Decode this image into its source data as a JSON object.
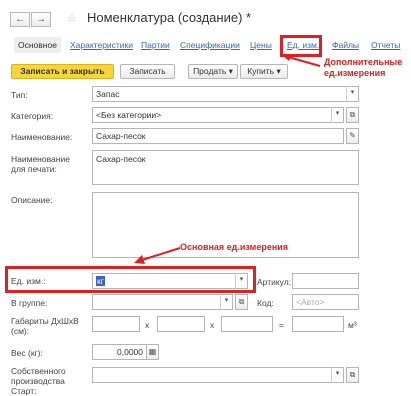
{
  "header": {
    "back_icon": "arrow-left-icon",
    "forward_icon": "arrow-right-icon",
    "favorite_icon": "star-icon",
    "title": "Номенклатура (создание) *"
  },
  "tabs": [
    {
      "label": "Основное",
      "active": true
    },
    {
      "label": "Характеристики"
    },
    {
      "label": "Партии"
    },
    {
      "label": "Спецификации"
    },
    {
      "label": "Цены"
    },
    {
      "label": "Ед. изм."
    },
    {
      "label": "Файлы"
    },
    {
      "label": "Отчеты"
    }
  ],
  "toolbar": {
    "save_close": "Записать и закрыть",
    "save": "Записать",
    "sell": "Продать",
    "buy": "Купить"
  },
  "form": {
    "type_label": "Тип:",
    "type_value": "Запас",
    "category_label": "Категория:",
    "category_value": "<Без категории>",
    "name_label": "Наименование:",
    "name_value": "Сахар-песок",
    "print_name_label": "Наименование для печати:",
    "print_name_value": "Сахар-песок",
    "description_label": "Описание:",
    "description_value": "",
    "unit_label": "Ед. изм.:",
    "unit_value": "кг",
    "article_label": "Артикул:",
    "group_label": "В группе:",
    "code_label": "Код:",
    "code_placeholder": "<Авто>",
    "dims_label": "Габариты ДхШхВ (см):",
    "x_sep": "х",
    "eq_sep": "=",
    "volume_unit": "м³",
    "weight_label": "Вес (кг):",
    "weight_value": "0,0000",
    "calc_icon": "calculator-icon",
    "own_prod_label": "Собственного производства Старт:"
  },
  "annotations": {
    "extra_units": "Дополнительные ед.измерения",
    "main_unit": "Основная ед.измерения",
    "highlight_color": "#e02020"
  }
}
